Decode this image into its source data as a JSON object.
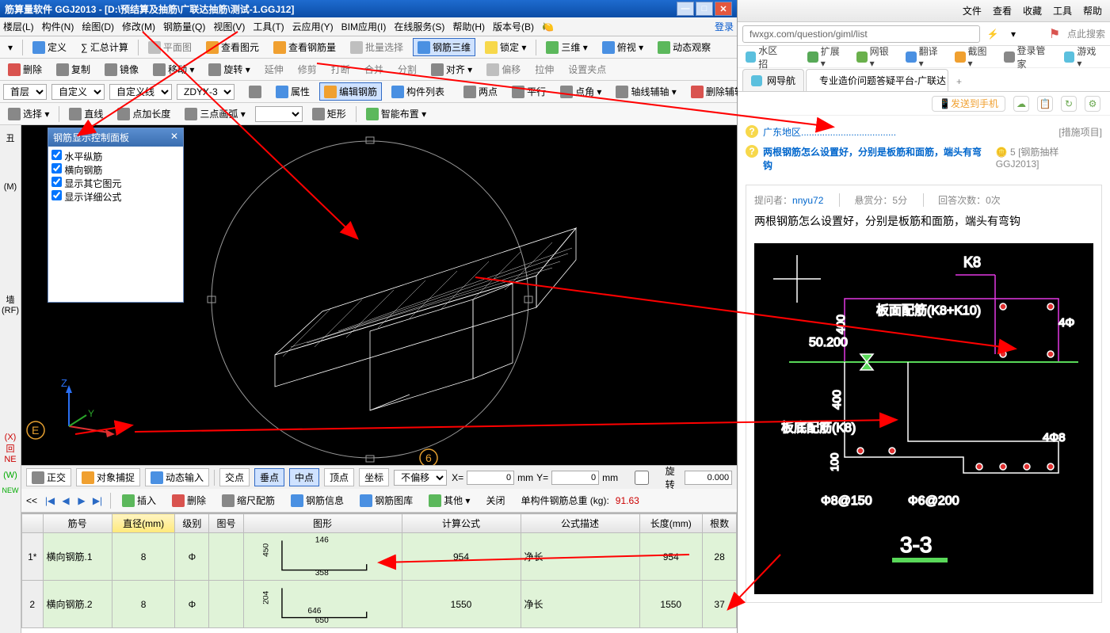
{
  "app": {
    "title": "筋算量软件 GGJ2013 - [D:\\预结算及抽筋\\广联达抽筋\\测试-1.GGJ12]"
  },
  "menu": {
    "items": [
      "楼层(L)",
      "构件(N)",
      "绘图(D)",
      "修改(M)",
      "钢筋量(Q)",
      "视图(V)",
      "工具(T)",
      "云应用(Y)",
      "BIM应用(I)",
      "在线服务(S)",
      "帮助(H)",
      "版本号(B)"
    ],
    "login": "登录",
    "extraIcon": "🍋"
  },
  "tb1": {
    "define": "定义",
    "sumcalc": "∑ 汇总计算",
    "plan": "平面图",
    "viewqty": "查看图元",
    "viewrebar": "查看钢筋量",
    "batchsel": "批量选择",
    "rebar3d": "钢筋三维",
    "lock": "锁定 ▾",
    "cube": "三维 ▾",
    "topview": "俯视 ▾",
    "dynobs": "动态观察"
  },
  "tb2": {
    "del": "删除",
    "copy": "复制",
    "mirror": "镜像",
    "move": "移动 ▾",
    "rotate": "旋转 ▾",
    "extend": "延伸",
    "trim": "修剪",
    "break": "打断",
    "merge": "合并",
    "split": "分割",
    "align": "对齐 ▾",
    "offset": "偏移",
    "pull": "拉伸",
    "setpt": "设置夹点"
  },
  "tb3": {
    "floor": "首层",
    "custom": "自定义",
    "customline": "自定义线",
    "zdyx": "ZDYX-3",
    "attr": "属性",
    "editrebar": "编辑钢筋",
    "complist": "构件列表",
    "twopt": "两点",
    "parallel": "平行",
    "ptangle": "点角 ▾",
    "axisaux": "轴线辅轴 ▾",
    "delaux": "删除辅轴"
  },
  "tb4": {
    "select": "选择 ▾",
    "line": "直线",
    "ptlen": "点加长度",
    "arc3": "三点画弧 ▾",
    "rect": "矩形",
    "autoplace": "智能布置 ▾"
  },
  "floatPanel": {
    "title": "钢筋显示控制面板",
    "opts": [
      "水平纵筋",
      "横向钢筋",
      "显示其它图元",
      "显示详细公式"
    ]
  },
  "leftPanel": {
    "items": [
      "丑",
      "(M)",
      "",
      "墙 (RF)",
      "",
      "(X)回NE",
      "(W)",
      "NEW"
    ]
  },
  "status": {
    "ortho": "正交",
    "osnap": "对象捕捉",
    "dyninput": "动态输入",
    "xpt": "交点",
    "perp": "垂点",
    "mid": "中点",
    "vert": "顶点",
    "coord": "坐标",
    "offsetmode": "不偏移",
    "x": "X=",
    "xv": "0",
    "y": "Y=",
    "yv": "0",
    "unit": "mm",
    "rotate": "旋转",
    "rotv": "0.000"
  },
  "dataTb": {
    "insert": "插入",
    "del": "删除",
    "scale": "缩尺配筋",
    "rebarinfo": "钢筋信息",
    "rebarlib": "钢筋图库",
    "other": "其他 ▾",
    "close": "关闭",
    "totalLabel": "单构件钢筋总重 (kg):",
    "totalVal": "91.63"
  },
  "grid": {
    "headers": [
      "",
      "筋号",
      "直径(mm)",
      "级别",
      "图号",
      "图形",
      "计算公式",
      "公式描述",
      "长度(mm)",
      "根数"
    ],
    "rows": [
      {
        "idx": "1*",
        "name": "横向钢筋.1",
        "dia": "8",
        "grade": "Φ",
        "figno": "",
        "calc": "954",
        "desc": "净长",
        "len": "954",
        "count": "28",
        "shape": {
          "top": "146",
          "left": "450",
          "bottom": "358"
        }
      },
      {
        "idx": "2",
        "name": "横向钢筋.2",
        "dia": "8",
        "grade": "Φ",
        "figno": "",
        "calc": "1550",
        "desc": "净长",
        "len": "1550",
        "count": "37",
        "shape": {
          "top": "",
          "left": "204",
          "bottom": "650",
          "mid": "646"
        }
      }
    ]
  },
  "browser": {
    "topmenu": [
      "文件",
      "查看",
      "收藏",
      "工具",
      "帮助"
    ],
    "url": "fwxgx.com/question/giml/list",
    "searchPlaceholder": "点此搜索",
    "ext": [
      {
        "t": "水区招",
        "c": "#888"
      },
      {
        "t": "扩展 ▾",
        "c": "#57a957"
      },
      {
        "t": "网银 ▾",
        "c": "#6ab04c"
      },
      {
        "t": "翻译 ▾",
        "c": "#4a90e2"
      },
      {
        "t": "截图 ▾",
        "c": "#f0a030"
      },
      {
        "t": "登录管家",
        "c": "#888"
      },
      {
        "t": "游戏 ▾",
        "c": "#5bc0de"
      }
    ],
    "tabs": [
      {
        "t": "网导航",
        "active": false
      },
      {
        "t": "专业造价问题答疑平台-广联达",
        "active": true
      }
    ],
    "actionSend": "发送到手机",
    "qlist": [
      {
        "t": "广东地区....................................",
        "meta": "[措施项目]",
        "cls": ""
      },
      {
        "t": "两根钢筋怎么设置好，分别是板筋和面筋，端头有弯钩",
        "meta": "🪙 5 [钢筋抽样GGJ2013]",
        "cls": "bold"
      }
    ],
    "post": {
      "asker": "提问者：",
      "askerName": "nnyu72",
      "bounty": "悬赏分：5分",
      "answers": "回答次数：0次",
      "title": "两根钢筋怎么设置好，分别是板筋和面筋，端头有弯钩"
    },
    "diagram": {
      "k8": "K8",
      "faceRebar": "板面配筋(K8+K10)",
      "lvl": "50.200",
      "botRebar": "板底配筋(K8)",
      "d1": "400",
      "d2": "400",
      "d3": "100",
      "s1": "Φ8@150",
      "s2": "Φ6@200",
      "sec": "3-3",
      "r1": "4Φ",
      "r2": "4Φ8"
    }
  }
}
